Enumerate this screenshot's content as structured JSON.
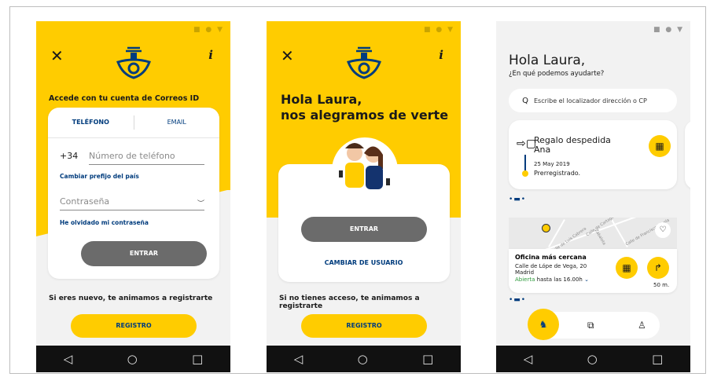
{
  "status_icons": "■ ● ▼",
  "nav": {
    "back": "◁",
    "home": "○",
    "recents": "□"
  },
  "screen1": {
    "close": "✕",
    "info": "i",
    "title": "Accede con tu cuenta de Correos ID",
    "tab_phone": "TELÉFONO",
    "tab_email": "EMAIL",
    "prefix": "+34",
    "phone_placeholder": "Número de teléfono",
    "change_prefix": "Cambiar prefijo del país",
    "password_placeholder": "Contraseña",
    "forgot": "He olvidado mi contraseña",
    "enter": "ENTRAR",
    "register_prompt": "Si eres nuevo, te animamos a registrarte",
    "register": "REGISTRO"
  },
  "screen2": {
    "close": "✕",
    "info": "i",
    "greeting_line1": "Hola Laura,",
    "greeting_line2": "nos alegramos de verte",
    "enter": "ENTRAR",
    "change_user": "CAMBIAR DE USUARIO",
    "register_prompt": "Si no tienes acceso, te animamos a registrarte",
    "register": "REGISTRO"
  },
  "screen3": {
    "hello": "Hola Laura,",
    "help": "¿En qué podemos ayudarte?",
    "search_placeholder": "Escribe el localizador dirección o CP",
    "shipment_title": "Regalo despedida Ana",
    "shipment_date": "25 May 2019",
    "shipment_status": "Prerregistrado.",
    "office_title": "Oficina más cercana",
    "office_address": "Calle de Lópe de Vega, 20",
    "office_city": "Madrid",
    "office_open": "Abierta",
    "office_hours": "hasta las 16.00h",
    "distance": "50 m.",
    "carousel_dots": "•▬•",
    "map_streets": [
      "Calle de Luis Cabrera",
      "Calle de Cartagena",
      "Zabaleta",
      "Calle de Francisco Silvela"
    ]
  }
}
